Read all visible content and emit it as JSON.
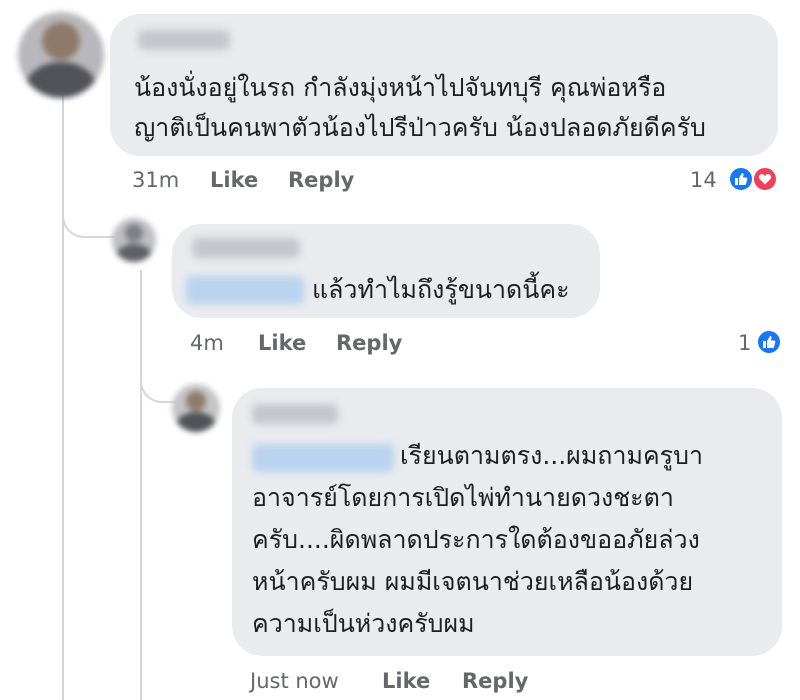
{
  "comments": [
    {
      "lines": [
        "น้องนั่งอยู่ในรถ กำลังมุ่งหน้าไปจันทบุรี  คุณพ่อหรือ",
        "ญาติเป็นคนพาตัวน้องไปรีป่าวครับ  น้องปลอดภัยดีครับ"
      ],
      "time": "31m",
      "like_label": "Like",
      "reply_label": "Reply",
      "reaction_count": "14",
      "reactions": [
        "like-icon",
        "love-icon"
      ]
    },
    {
      "lines": [
        "แล้วทำไมถึงรู้ขนาดนี้คะ"
      ],
      "time": "4m",
      "like_label": "Like",
      "reply_label": "Reply",
      "reaction_count": "1",
      "reactions": [
        "like-icon"
      ]
    },
    {
      "lines": [
        "เรียนตามตรง...ผมถามครูบา",
        "อาจารย์โดยการเปิดไพ่ทำนายดวงชะตา",
        "ครับ....ผิดพลาดประการใดต้องขออภัยล่วง",
        "หน้าครับผม  ผมมีเจตนาช่วยเหลือน้องด้วย",
        "ความเป็นห่วงครับผม"
      ],
      "time": "Just now",
      "like_label": "Like",
      "reply_label": "Reply"
    }
  ],
  "colors": {
    "bubble": "#eaebef",
    "meta_text": "#65676b",
    "like": "#1877f2",
    "love": "#f33e58"
  }
}
